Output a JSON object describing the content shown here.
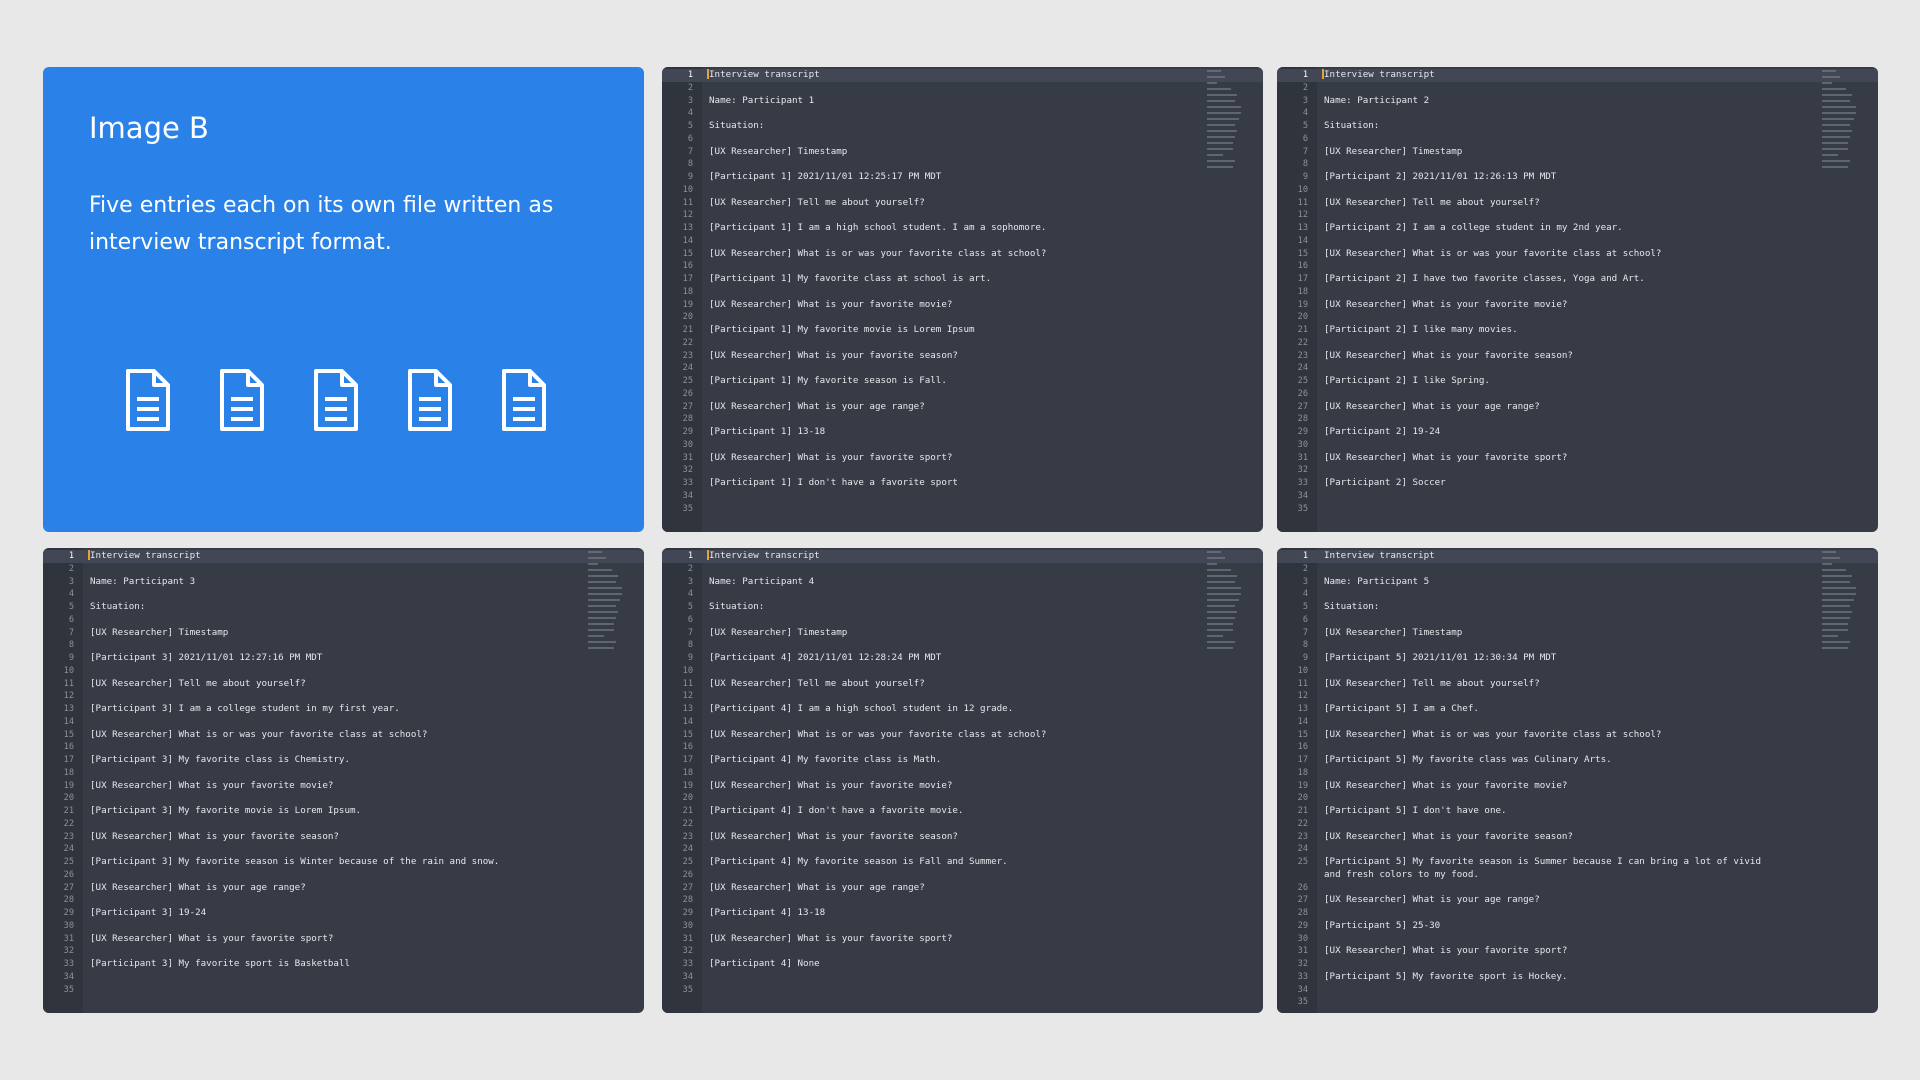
{
  "intro": {
    "title": "Image B",
    "description": "Five entries each on its own file written as interview transcript format.",
    "accent_color": "#2a82e8",
    "icons": [
      "document-icon",
      "document-icon",
      "document-icon",
      "document-icon",
      "document-icon"
    ]
  },
  "editors": [
    {
      "lines": [
        {
          "n": "1",
          "t": "Interview transcript"
        },
        {
          "n": "2",
          "t": ""
        },
        {
          "n": "3",
          "t": "Name: Participant 1"
        },
        {
          "n": "4",
          "t": ""
        },
        {
          "n": "5",
          "t": "Situation:"
        },
        {
          "n": "6",
          "t": ""
        },
        {
          "n": "7",
          "t": "[UX Researcher] Timestamp"
        },
        {
          "n": "8",
          "t": ""
        },
        {
          "n": "9",
          "t": "[Participant 1] 2021/11/01 12:25:17 PM MDT"
        },
        {
          "n": "10",
          "t": ""
        },
        {
          "n": "11",
          "t": "[UX Researcher] Tell me about yourself?"
        },
        {
          "n": "12",
          "t": ""
        },
        {
          "n": "13",
          "t": "[Participant 1] I am a high school student. I am a sophomore."
        },
        {
          "n": "14",
          "t": ""
        },
        {
          "n": "15",
          "t": "[UX Researcher] What is or was your favorite class at school?"
        },
        {
          "n": "16",
          "t": ""
        },
        {
          "n": "17",
          "t": "[Participant 1] My favorite class at school is art."
        },
        {
          "n": "18",
          "t": ""
        },
        {
          "n": "19",
          "t": "[UX Researcher] What is your favorite movie?"
        },
        {
          "n": "20",
          "t": ""
        },
        {
          "n": "21",
          "t": "[Participant 1] My favorite movie is Lorem Ipsum"
        },
        {
          "n": "22",
          "t": ""
        },
        {
          "n": "23",
          "t": "[UX Researcher] What is your favorite season?"
        },
        {
          "n": "24",
          "t": ""
        },
        {
          "n": "25",
          "t": "[Participant 1] My favorite season is Fall."
        },
        {
          "n": "26",
          "t": ""
        },
        {
          "n": "27",
          "t": "[UX Researcher] What is your age range?"
        },
        {
          "n": "28",
          "t": ""
        },
        {
          "n": "29",
          "t": "[Participant 1] 13-18"
        },
        {
          "n": "30",
          "t": ""
        },
        {
          "n": "31",
          "t": "[UX Researcher] What is your favorite sport?"
        },
        {
          "n": "32",
          "t": ""
        },
        {
          "n": "33",
          "t": "[Participant 1] I don't have a favorite sport"
        },
        {
          "n": "34",
          "t": ""
        },
        {
          "n": "35",
          "t": ""
        }
      ]
    },
    {
      "lines": [
        {
          "n": "1",
          "t": "Interview transcript"
        },
        {
          "n": "2",
          "t": ""
        },
        {
          "n": "3",
          "t": "Name: Participant 2"
        },
        {
          "n": "4",
          "t": ""
        },
        {
          "n": "5",
          "t": "Situation:"
        },
        {
          "n": "6",
          "t": ""
        },
        {
          "n": "7",
          "t": "[UX Researcher] Timestamp"
        },
        {
          "n": "8",
          "t": ""
        },
        {
          "n": "9",
          "t": "[Participant 2] 2021/11/01 12:26:13 PM MDT"
        },
        {
          "n": "10",
          "t": ""
        },
        {
          "n": "11",
          "t": "[UX Researcher] Tell me about yourself?"
        },
        {
          "n": "12",
          "t": ""
        },
        {
          "n": "13",
          "t": "[Participant 2] I am a college student in my 2nd year."
        },
        {
          "n": "14",
          "t": ""
        },
        {
          "n": "15",
          "t": "[UX Researcher] What is or was your favorite class at school?"
        },
        {
          "n": "16",
          "t": ""
        },
        {
          "n": "17",
          "t": "[Participant 2] I have two favorite classes, Yoga and Art."
        },
        {
          "n": "18",
          "t": ""
        },
        {
          "n": "19",
          "t": "[UX Researcher] What is your favorite movie?"
        },
        {
          "n": "20",
          "t": ""
        },
        {
          "n": "21",
          "t": "[Participant 2] I like many movies."
        },
        {
          "n": "22",
          "t": ""
        },
        {
          "n": "23",
          "t": "[UX Researcher] What is your favorite season?"
        },
        {
          "n": "24",
          "t": ""
        },
        {
          "n": "25",
          "t": "[Participant 2] I like Spring."
        },
        {
          "n": "26",
          "t": ""
        },
        {
          "n": "27",
          "t": "[UX Researcher] What is your age range?"
        },
        {
          "n": "28",
          "t": ""
        },
        {
          "n": "29",
          "t": "[Participant 2] 19-24"
        },
        {
          "n": "30",
          "t": ""
        },
        {
          "n": "31",
          "t": "[UX Researcher] What is your favorite sport?"
        },
        {
          "n": "32",
          "t": ""
        },
        {
          "n": "33",
          "t": "[Participant 2] Soccer"
        },
        {
          "n": "34",
          "t": ""
        },
        {
          "n": "35",
          "t": ""
        }
      ]
    },
    {
      "lines": [
        {
          "n": "1",
          "t": "Interview transcript"
        },
        {
          "n": "2",
          "t": ""
        },
        {
          "n": "3",
          "t": "Name: Participant 3"
        },
        {
          "n": "4",
          "t": ""
        },
        {
          "n": "5",
          "t": "Situation:"
        },
        {
          "n": "6",
          "t": ""
        },
        {
          "n": "7",
          "t": "[UX Researcher] Timestamp"
        },
        {
          "n": "8",
          "t": ""
        },
        {
          "n": "9",
          "t": "[Participant 3] 2021/11/01 12:27:16 PM MDT"
        },
        {
          "n": "10",
          "t": ""
        },
        {
          "n": "11",
          "t": "[UX Researcher] Tell me about yourself?"
        },
        {
          "n": "12",
          "t": ""
        },
        {
          "n": "13",
          "t": "[Participant 3] I am a college student in my first year."
        },
        {
          "n": "14",
          "t": ""
        },
        {
          "n": "15",
          "t": "[UX Researcher] What is or was your favorite class at school?"
        },
        {
          "n": "16",
          "t": ""
        },
        {
          "n": "17",
          "t": "[Participant 3] My favorite class is Chemistry."
        },
        {
          "n": "18",
          "t": ""
        },
        {
          "n": "19",
          "t": "[UX Researcher] What is your favorite movie?"
        },
        {
          "n": "20",
          "t": ""
        },
        {
          "n": "21",
          "t": "[Participant 3] My favorite movie is Lorem Ipsum."
        },
        {
          "n": "22",
          "t": ""
        },
        {
          "n": "23",
          "t": "[UX Researcher] What is your favorite season?"
        },
        {
          "n": "24",
          "t": ""
        },
        {
          "n": "25",
          "t": "[Participant 3] My favorite season is Winter because of the rain and snow."
        },
        {
          "n": "26",
          "t": ""
        },
        {
          "n": "27",
          "t": "[UX Researcher] What is your age range?"
        },
        {
          "n": "28",
          "t": ""
        },
        {
          "n": "29",
          "t": "[Participant 3] 19-24"
        },
        {
          "n": "30",
          "t": ""
        },
        {
          "n": "31",
          "t": "[UX Researcher] What is your favorite sport?"
        },
        {
          "n": "32",
          "t": ""
        },
        {
          "n": "33",
          "t": "[Participant 3] My favorite sport is Basketball"
        },
        {
          "n": "34",
          "t": ""
        },
        {
          "n": "35",
          "t": ""
        }
      ]
    },
    {
      "lines": [
        {
          "n": "1",
          "t": "Interview transcript"
        },
        {
          "n": "2",
          "t": ""
        },
        {
          "n": "3",
          "t": "Name: Participant 4"
        },
        {
          "n": "4",
          "t": ""
        },
        {
          "n": "5",
          "t": "Situation:"
        },
        {
          "n": "6",
          "t": ""
        },
        {
          "n": "7",
          "t": "[UX Researcher] Timestamp"
        },
        {
          "n": "8",
          "t": ""
        },
        {
          "n": "9",
          "t": "[Participant 4] 2021/11/01 12:28:24 PM MDT"
        },
        {
          "n": "10",
          "t": ""
        },
        {
          "n": "11",
          "t": "[UX Researcher] Tell me about yourself?"
        },
        {
          "n": "12",
          "t": ""
        },
        {
          "n": "13",
          "t": "[Participant 4] I am a high school student in 12 grade."
        },
        {
          "n": "14",
          "t": ""
        },
        {
          "n": "15",
          "t": "[UX Researcher] What is or was your favorite class at school?"
        },
        {
          "n": "16",
          "t": ""
        },
        {
          "n": "17",
          "t": "[Participant 4] My favorite class is Math."
        },
        {
          "n": "18",
          "t": ""
        },
        {
          "n": "19",
          "t": "[UX Researcher] What is your favorite movie?"
        },
        {
          "n": "20",
          "t": ""
        },
        {
          "n": "21",
          "t": "[Participant 4] I don't have a favorite movie."
        },
        {
          "n": "22",
          "t": ""
        },
        {
          "n": "23",
          "t": "[UX Researcher] What is your favorite season?"
        },
        {
          "n": "24",
          "t": ""
        },
        {
          "n": "25",
          "t": "[Participant 4] My favorite season is Fall and Summer."
        },
        {
          "n": "26",
          "t": ""
        },
        {
          "n": "27",
          "t": "[UX Researcher] What is your age range?"
        },
        {
          "n": "28",
          "t": ""
        },
        {
          "n": "29",
          "t": "[Participant 4] 13-18"
        },
        {
          "n": "30",
          "t": ""
        },
        {
          "n": "31",
          "t": "[UX Researcher] What is your favorite sport?"
        },
        {
          "n": "32",
          "t": ""
        },
        {
          "n": "33",
          "t": "[Participant 4] None"
        },
        {
          "n": "34",
          "t": ""
        },
        {
          "n": "35",
          "t": ""
        }
      ]
    },
    {
      "lines": [
        {
          "n": "1",
          "t": "Interview transcript"
        },
        {
          "n": "2",
          "t": ""
        },
        {
          "n": "3",
          "t": "Name: Participant 5"
        },
        {
          "n": "4",
          "t": ""
        },
        {
          "n": "5",
          "t": "Situation:"
        },
        {
          "n": "6",
          "t": ""
        },
        {
          "n": "7",
          "t": "[UX Researcher] Timestamp"
        },
        {
          "n": "8",
          "t": ""
        },
        {
          "n": "9",
          "t": "[Participant 5] 2021/11/01 12:30:34 PM MDT"
        },
        {
          "n": "10",
          "t": ""
        },
        {
          "n": "11",
          "t": "[UX Researcher] Tell me about yourself?"
        },
        {
          "n": "12",
          "t": ""
        },
        {
          "n": "13",
          "t": "[Participant 5] I am a Chef."
        },
        {
          "n": "14",
          "t": ""
        },
        {
          "n": "15",
          "t": "[UX Researcher] What is or was your favorite class at school?"
        },
        {
          "n": "16",
          "t": ""
        },
        {
          "n": "17",
          "t": "[Participant 5] My favorite class was Culinary Arts."
        },
        {
          "n": "18",
          "t": ""
        },
        {
          "n": "19",
          "t": "[UX Researcher] What is your favorite movie?"
        },
        {
          "n": "20",
          "t": ""
        },
        {
          "n": "21",
          "t": "[Participant 5] I don't have one."
        },
        {
          "n": "22",
          "t": ""
        },
        {
          "n": "23",
          "t": "[UX Researcher] What is your favorite season?"
        },
        {
          "n": "24",
          "t": ""
        },
        {
          "n": "25",
          "t": "[Participant 5] My favorite season is Summer because I can bring a lot of vivid\nand fresh colors to my food."
        },
        {
          "n": "26",
          "t": ""
        },
        {
          "n": "27",
          "t": "[UX Researcher] What is your age range?"
        },
        {
          "n": "28",
          "t": ""
        },
        {
          "n": "29",
          "t": "[Participant 5] 25-30"
        },
        {
          "n": "30",
          "t": ""
        },
        {
          "n": "31",
          "t": "[UX Researcher] What is your favorite sport?"
        },
        {
          "n": "32",
          "t": ""
        },
        {
          "n": "33",
          "t": "[Participant 5] My favorite sport is Hockey."
        },
        {
          "n": "34",
          "t": ""
        },
        {
          "n": "35",
          "t": ""
        }
      ]
    }
  ]
}
